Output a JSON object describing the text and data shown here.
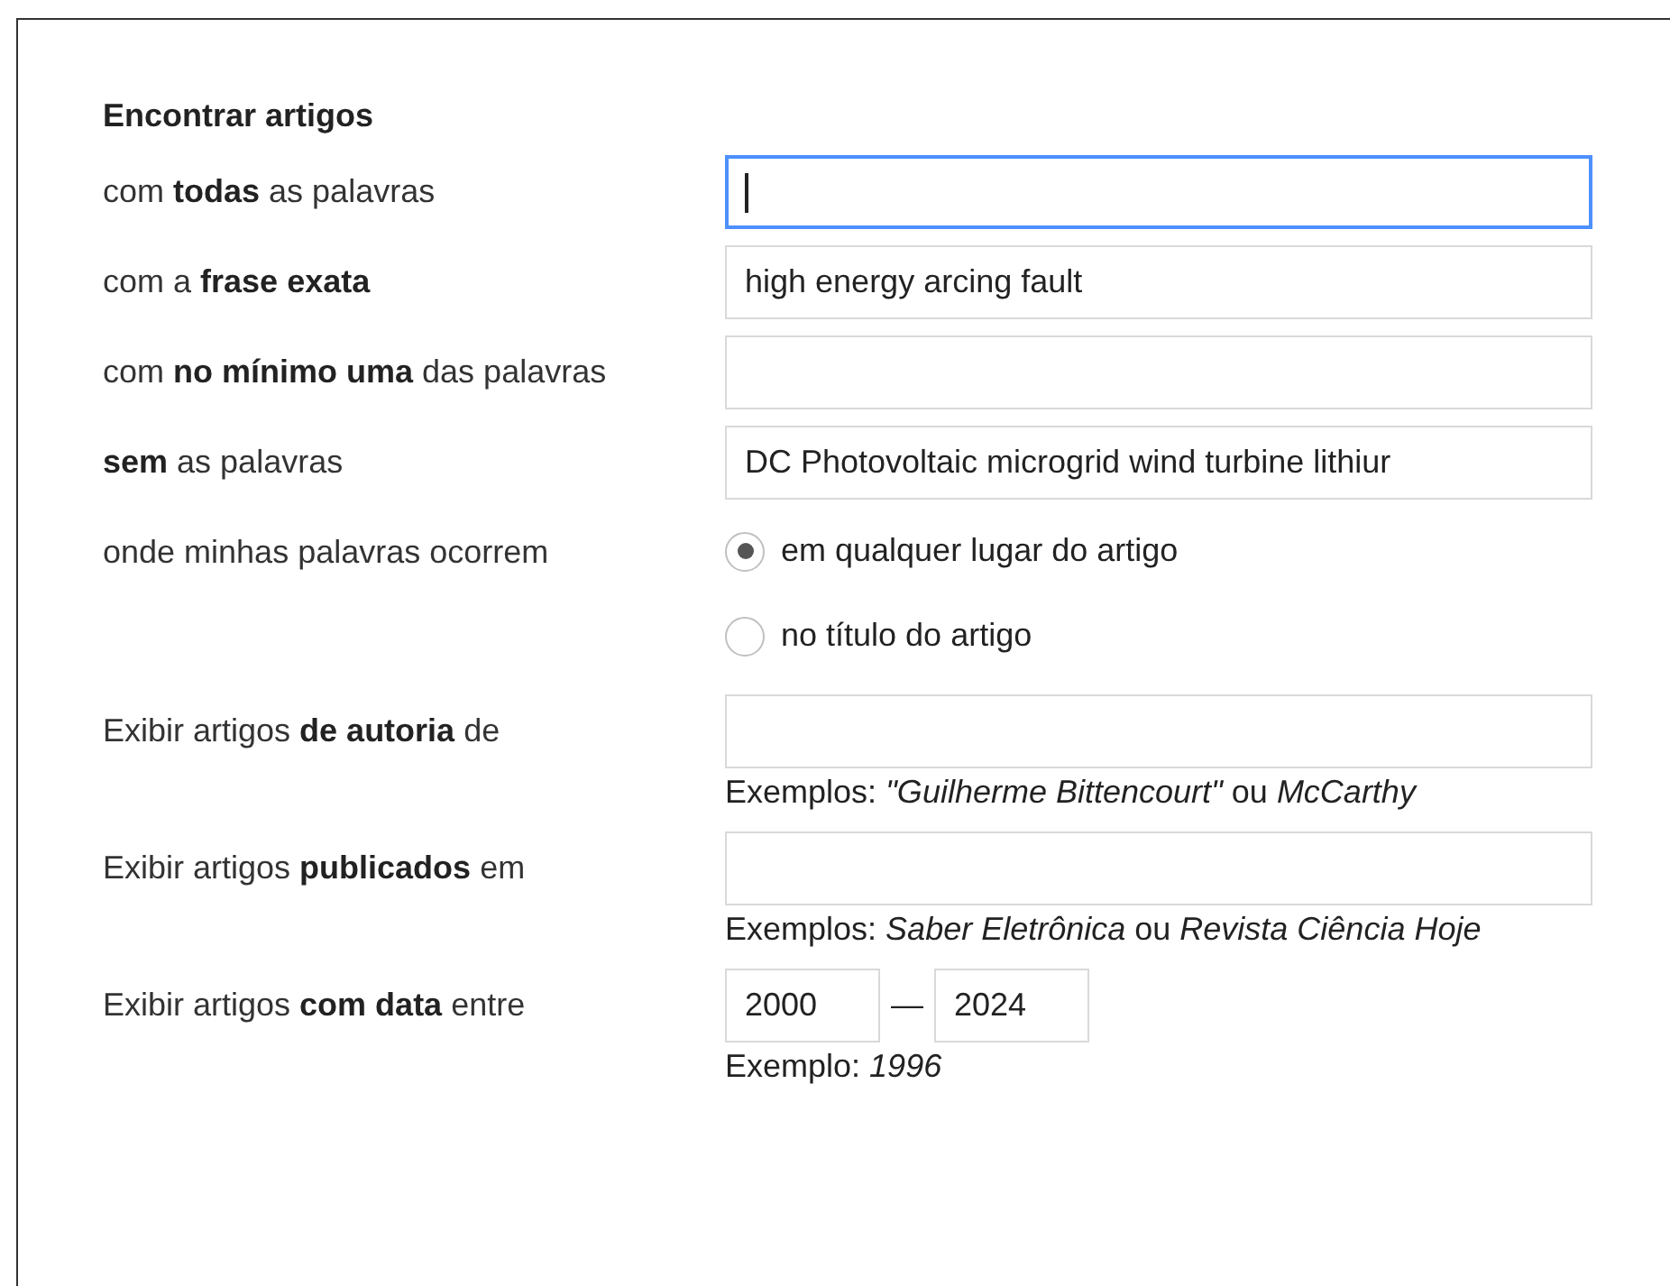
{
  "heading": "Encontrar artigos",
  "rows": [
    {
      "kind": "text",
      "label": "com **todas** as palavras",
      "value": "",
      "focused": true
    },
    {
      "kind": "text",
      "label": "com a **frase exata**",
      "value": "high energy arcing fault",
      "focused": false
    },
    {
      "kind": "text",
      "label": "com **no mínimo uma** das palavras",
      "value": "",
      "focused": false
    },
    {
      "kind": "text",
      "label": "**sem** as palavras",
      "value": "DC Photovoltaic microgrid wind turbine lithiur",
      "focused": false
    },
    {
      "kind": "radio",
      "label": "onde minhas palavras ocorrem",
      "options": [
        {
          "label": "em qualquer lugar do artigo",
          "selected": true
        },
        {
          "label": "no título do artigo",
          "selected": false
        }
      ]
    },
    {
      "kind": "text",
      "label": "Exibir artigos **de autoria** de",
      "value": "",
      "focused": false,
      "hint": "Exemplos: *\"Guilherme Bittencourt\"* ou *McCarthy*"
    },
    {
      "kind": "text",
      "label": "Exibir artigos **publicados** em",
      "value": "",
      "focused": false,
      "hint": "Exemplos: *Saber Eletrônica* ou *Revista Ciência Hoje*"
    },
    {
      "kind": "range",
      "label": "Exibir artigos **com data** entre",
      "from": "2000",
      "separator": "—",
      "to": "2024",
      "hint": "Exemplo: *1996*"
    }
  ]
}
